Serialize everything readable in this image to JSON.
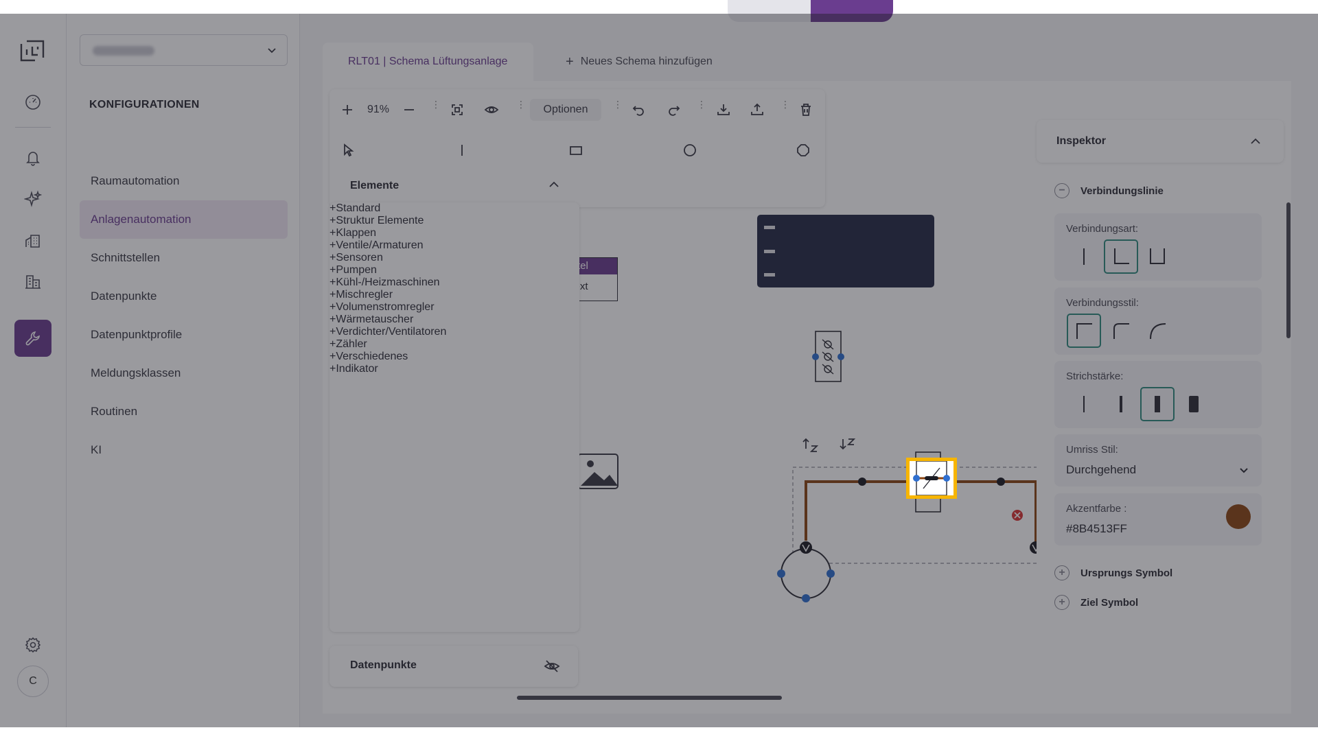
{
  "rail": {
    "icons": [
      "logo-icon",
      "dashboard-icon",
      "bell-icon",
      "sparkle-icon",
      "buildings-icon",
      "building-data-icon",
      "wrench-icon",
      "gear-icon"
    ],
    "avatar_initial": "C"
  },
  "sidebar": {
    "heading": "KONFIGURATIONEN",
    "items": [
      {
        "label": "Raumautomation",
        "active": false
      },
      {
        "label": "Anlagenautomation",
        "active": true
      },
      {
        "label": "Schnittstellen",
        "active": false
      },
      {
        "label": "Datenpunkte",
        "active": false
      },
      {
        "label": "Datenpunktprofile",
        "active": false
      },
      {
        "label": "Meldungsklassen",
        "active": false
      },
      {
        "label": "Routinen",
        "active": false
      },
      {
        "label": "KI",
        "active": false
      }
    ]
  },
  "tabs": {
    "active_label": "RLT01 | Schema Lüftungsanlage",
    "add_label": "Neues Schema hinzufügen"
  },
  "toolbar": {
    "zoom": "91%",
    "options_label": "Optionen"
  },
  "elements": {
    "title": "Elemente",
    "items": [
      "Standard",
      "Struktur Elemente",
      "Klappen",
      "Ventile/Armaturen",
      "Sensoren",
      "Pumpen",
      "Kühl-/Heizmaschinen",
      "Mischregler",
      "Volumenstromregler",
      "Wärmetauscher",
      "Verdichter/Ventilatoren",
      "Zähler",
      "Verschiedenes",
      "Indikator"
    ]
  },
  "datapoints_panel": {
    "title": "Datenpunkte"
  },
  "canvas": {
    "card_title": "Titel",
    "card_text": "Text"
  },
  "inspector": {
    "title": "Inspektor",
    "section_title": "Verbindungslinie",
    "connection_type_label": "Verbindungsart:",
    "connection_style_label": "Verbindungsstil:",
    "stroke_width_label": "Strichstärke:",
    "outline_style_label": "Umriss Stil:",
    "outline_style_value": "Durchgehend",
    "accent_color_label": "Akzentfarbe :",
    "accent_color_value": "#8B4513FF",
    "accent_color": "#8B4513",
    "origin_symbol_label": "Ursprungs Symbol",
    "target_symbol_label": "Ziel Symbol"
  },
  "colors": {
    "brand": "#6A3D8F",
    "selected_outline": "#2F8A7E",
    "highlight": "#F7B500",
    "handle": "#2F6FD0"
  }
}
